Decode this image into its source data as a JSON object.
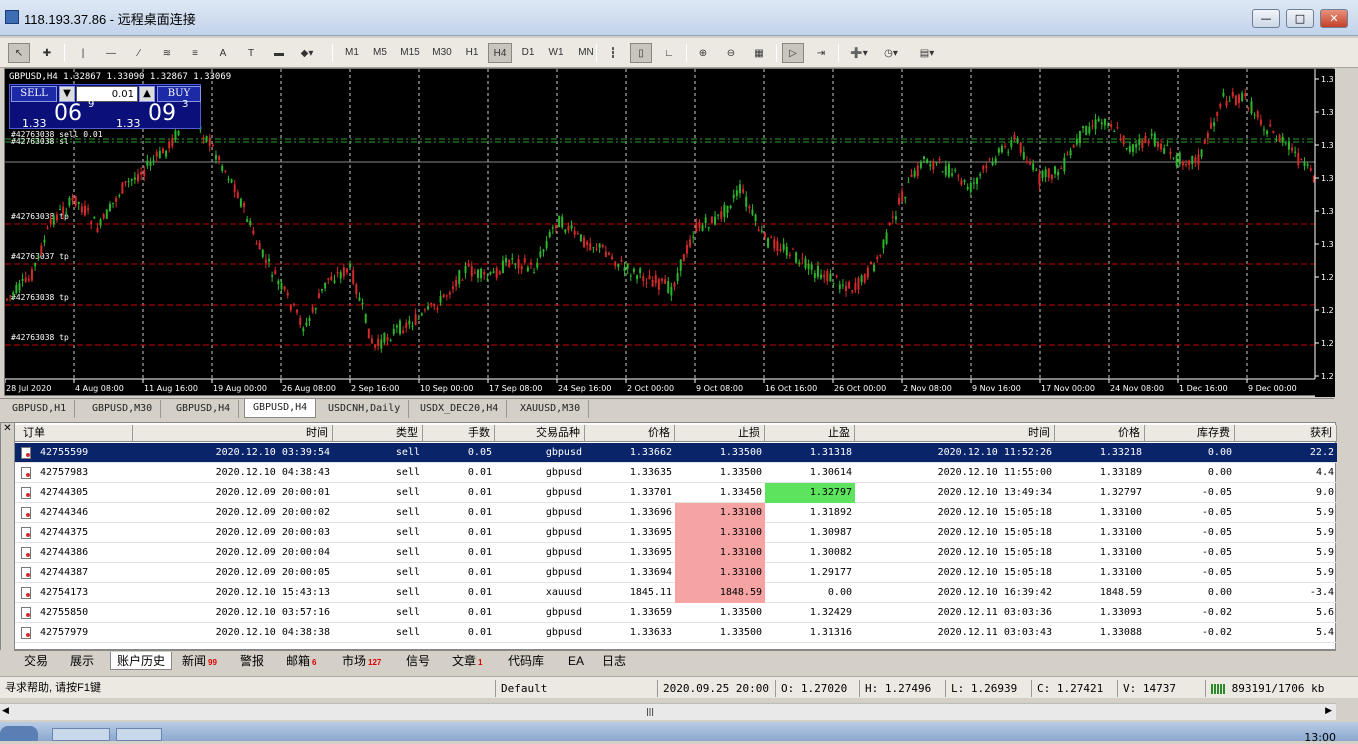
{
  "window": {
    "title": "118.193.37.86 - 远程桌面连接"
  },
  "toolbar": {
    "timeframes": [
      "M1",
      "M5",
      "M15",
      "M30",
      "H1",
      "H4",
      "D1",
      "W1",
      "MN"
    ],
    "active_timeframe": "H4"
  },
  "chart": {
    "symbol_info": "GBPUSD,H4  1.32867 1.33090 1.32867 1.33069",
    "trade_panel": {
      "sell_label": "SELL",
      "buy_label": "BUY",
      "lot": "0.01",
      "sell_prefix": "1.33",
      "sell_big": "06",
      "sell_sup": "9",
      "buy_prefix": "1.33",
      "buy_big": "09",
      "buy_sup": "3"
    },
    "order_labels": [
      "#42763038 sell 0.01",
      "#42763038 sl",
      "#42763038 tp",
      "#42763037 tp",
      "#42763038 tp",
      "#42763038 tp"
    ],
    "x_ticks": [
      "28 Jul 2020",
      "4 Aug 08:00",
      "11 Aug 16:00",
      "19 Aug 00:00",
      "26 Aug 08:00",
      "2 Sep 16:00",
      "10 Sep 00:00",
      "17 Sep 08:00",
      "24 Sep 16:00",
      "2 Oct 00:00",
      "9 Oct 08:00",
      "16 Oct 16:00",
      "26 Oct 00:00",
      "2 Nov 08:00",
      "9 Nov 16:00",
      "17 Nov 00:00",
      "24 Nov 08:00",
      "1 Dec 16:00",
      "9 Dec 00:00"
    ],
    "y_ticks": [
      "1.3",
      "1.3",
      "1.3",
      "1.3",
      "1.3",
      "1.3",
      "1.2",
      "1.2",
      "1.2",
      "1.2",
      "1.2"
    ]
  },
  "chart_tabs": [
    "GBPUSD,H1",
    "GBPUSD,M30",
    "GBPUSD,H4",
    "GBPUSD,H4",
    "USDCNH,Daily",
    "USDX_DEC20,H4",
    "XAUUSD,M30"
  ],
  "active_chart_tab": 3,
  "terminal": {
    "columns": [
      "订单",
      "时间",
      "类型",
      "手数",
      "交易品种",
      "价格",
      "止损",
      "止盈",
      "时间",
      "价格",
      "库存费",
      "获利"
    ],
    "rows": [
      {
        "ticket": "42755599",
        "open_time": "2020.12.10 03:39:54",
        "type": "sell",
        "lots": "0.05",
        "symbol": "gbpusd",
        "price": "1.33662",
        "sl": "1.33500",
        "tp": "1.31318",
        "close_time": "2020.12.10 11:52:26",
        "close_price": "1.33218",
        "swap": "0.00",
        "profit": "22.2",
        "selected": true,
        "sl_hl": "",
        "tp_hl": ""
      },
      {
        "ticket": "42757983",
        "open_time": "2020.12.10 04:38:43",
        "type": "sell",
        "lots": "0.01",
        "symbol": "gbpusd",
        "price": "1.33635",
        "sl": "1.33500",
        "tp": "1.30614",
        "close_time": "2020.12.10 11:55:00",
        "close_price": "1.33189",
        "swap": "0.00",
        "profit": "4.4",
        "selected": false,
        "sl_hl": "",
        "tp_hl": ""
      },
      {
        "ticket": "42744305",
        "open_time": "2020.12.09 20:00:01",
        "type": "sell",
        "lots": "0.01",
        "symbol": "gbpusd",
        "price": "1.33701",
        "sl": "1.33450",
        "tp": "1.32797",
        "close_time": "2020.12.10 13:49:34",
        "close_price": "1.32797",
        "swap": "-0.05",
        "profit": "9.0",
        "selected": false,
        "sl_hl": "",
        "tp_hl": "green"
      },
      {
        "ticket": "42744346",
        "open_time": "2020.12.09 20:00:02",
        "type": "sell",
        "lots": "0.01",
        "symbol": "gbpusd",
        "price": "1.33696",
        "sl": "1.33100",
        "tp": "1.31892",
        "close_time": "2020.12.10 15:05:18",
        "close_price": "1.33100",
        "swap": "-0.05",
        "profit": "5.9",
        "selected": false,
        "sl_hl": "red",
        "tp_hl": ""
      },
      {
        "ticket": "42744375",
        "open_time": "2020.12.09 20:00:03",
        "type": "sell",
        "lots": "0.01",
        "symbol": "gbpusd",
        "price": "1.33695",
        "sl": "1.33100",
        "tp": "1.30987",
        "close_time": "2020.12.10 15:05:18",
        "close_price": "1.33100",
        "swap": "-0.05",
        "profit": "5.9",
        "selected": false,
        "sl_hl": "red",
        "tp_hl": ""
      },
      {
        "ticket": "42744386",
        "open_time": "2020.12.09 20:00:04",
        "type": "sell",
        "lots": "0.01",
        "symbol": "gbpusd",
        "price": "1.33695",
        "sl": "1.33100",
        "tp": "1.30082",
        "close_time": "2020.12.10 15:05:18",
        "close_price": "1.33100",
        "swap": "-0.05",
        "profit": "5.9",
        "selected": false,
        "sl_hl": "red",
        "tp_hl": ""
      },
      {
        "ticket": "42744387",
        "open_time": "2020.12.09 20:00:05",
        "type": "sell",
        "lots": "0.01",
        "symbol": "gbpusd",
        "price": "1.33694",
        "sl": "1.33100",
        "tp": "1.29177",
        "close_time": "2020.12.10 15:05:18",
        "close_price": "1.33100",
        "swap": "-0.05",
        "profit": "5.9",
        "selected": false,
        "sl_hl": "red",
        "tp_hl": ""
      },
      {
        "ticket": "42754173",
        "open_time": "2020.12.10 15:43:13",
        "type": "sell",
        "lots": "0.01",
        "symbol": "xauusd",
        "price": "1845.11",
        "sl": "1848.59",
        "tp": "0.00",
        "close_time": "2020.12.10 16:39:42",
        "close_price": "1848.59",
        "swap": "0.00",
        "profit": "-3.4",
        "selected": false,
        "sl_hl": "red",
        "tp_hl": ""
      },
      {
        "ticket": "42755850",
        "open_time": "2020.12.10 03:57:16",
        "type": "sell",
        "lots": "0.01",
        "symbol": "gbpusd",
        "price": "1.33659",
        "sl": "1.33500",
        "tp": "1.32429",
        "close_time": "2020.12.11 03:03:36",
        "close_price": "1.33093",
        "swap": "-0.02",
        "profit": "5.6",
        "selected": false,
        "sl_hl": "",
        "tp_hl": ""
      },
      {
        "ticket": "42757979",
        "open_time": "2020.12.10 04:38:38",
        "type": "sell",
        "lots": "0.01",
        "symbol": "gbpusd",
        "price": "1.33633",
        "sl": "1.33500",
        "tp": "1.31316",
        "close_time": "2020.12.11 03:03:43",
        "close_price": "1.33088",
        "swap": "-0.02",
        "profit": "5.4",
        "selected": false,
        "sl_hl": "",
        "tp_hl": ""
      }
    ]
  },
  "bottom_tabs": [
    {
      "label": "交易",
      "badge": ""
    },
    {
      "label": "展示",
      "badge": ""
    },
    {
      "label": "账户历史",
      "badge": ""
    },
    {
      "label": "新闻",
      "badge": "99"
    },
    {
      "label": "警报",
      "badge": ""
    },
    {
      "label": "邮箱",
      "badge": "6"
    },
    {
      "label": "市场",
      "badge": "127"
    },
    {
      "label": "信号",
      "badge": ""
    },
    {
      "label": "文章",
      "badge": "1"
    },
    {
      "label": "代码库",
      "badge": ""
    },
    {
      "label": "EA",
      "badge": ""
    },
    {
      "label": "日志",
      "badge": ""
    }
  ],
  "active_bottom_tab": 2,
  "status": {
    "help": "寻求帮助, 请按F1键",
    "profile": "Default",
    "datetime": "2020.09.25 20:00",
    "open": "O: 1.27020",
    "high": "H: 1.27496",
    "low": "L: 1.26939",
    "close": "C: 1.27421",
    "volume": "V: 14737",
    "traffic": "893191/1706 kb"
  },
  "taskbar": {
    "clock": "13:00"
  },
  "colors": {
    "bull": "#2db52d",
    "bear": "#d42a2a",
    "grid": "#ffffff",
    "order_line": "#cc0000",
    "selection": "#0a246a",
    "sl_hit": "#f5a3a3",
    "tp_hit": "#5de35d"
  }
}
